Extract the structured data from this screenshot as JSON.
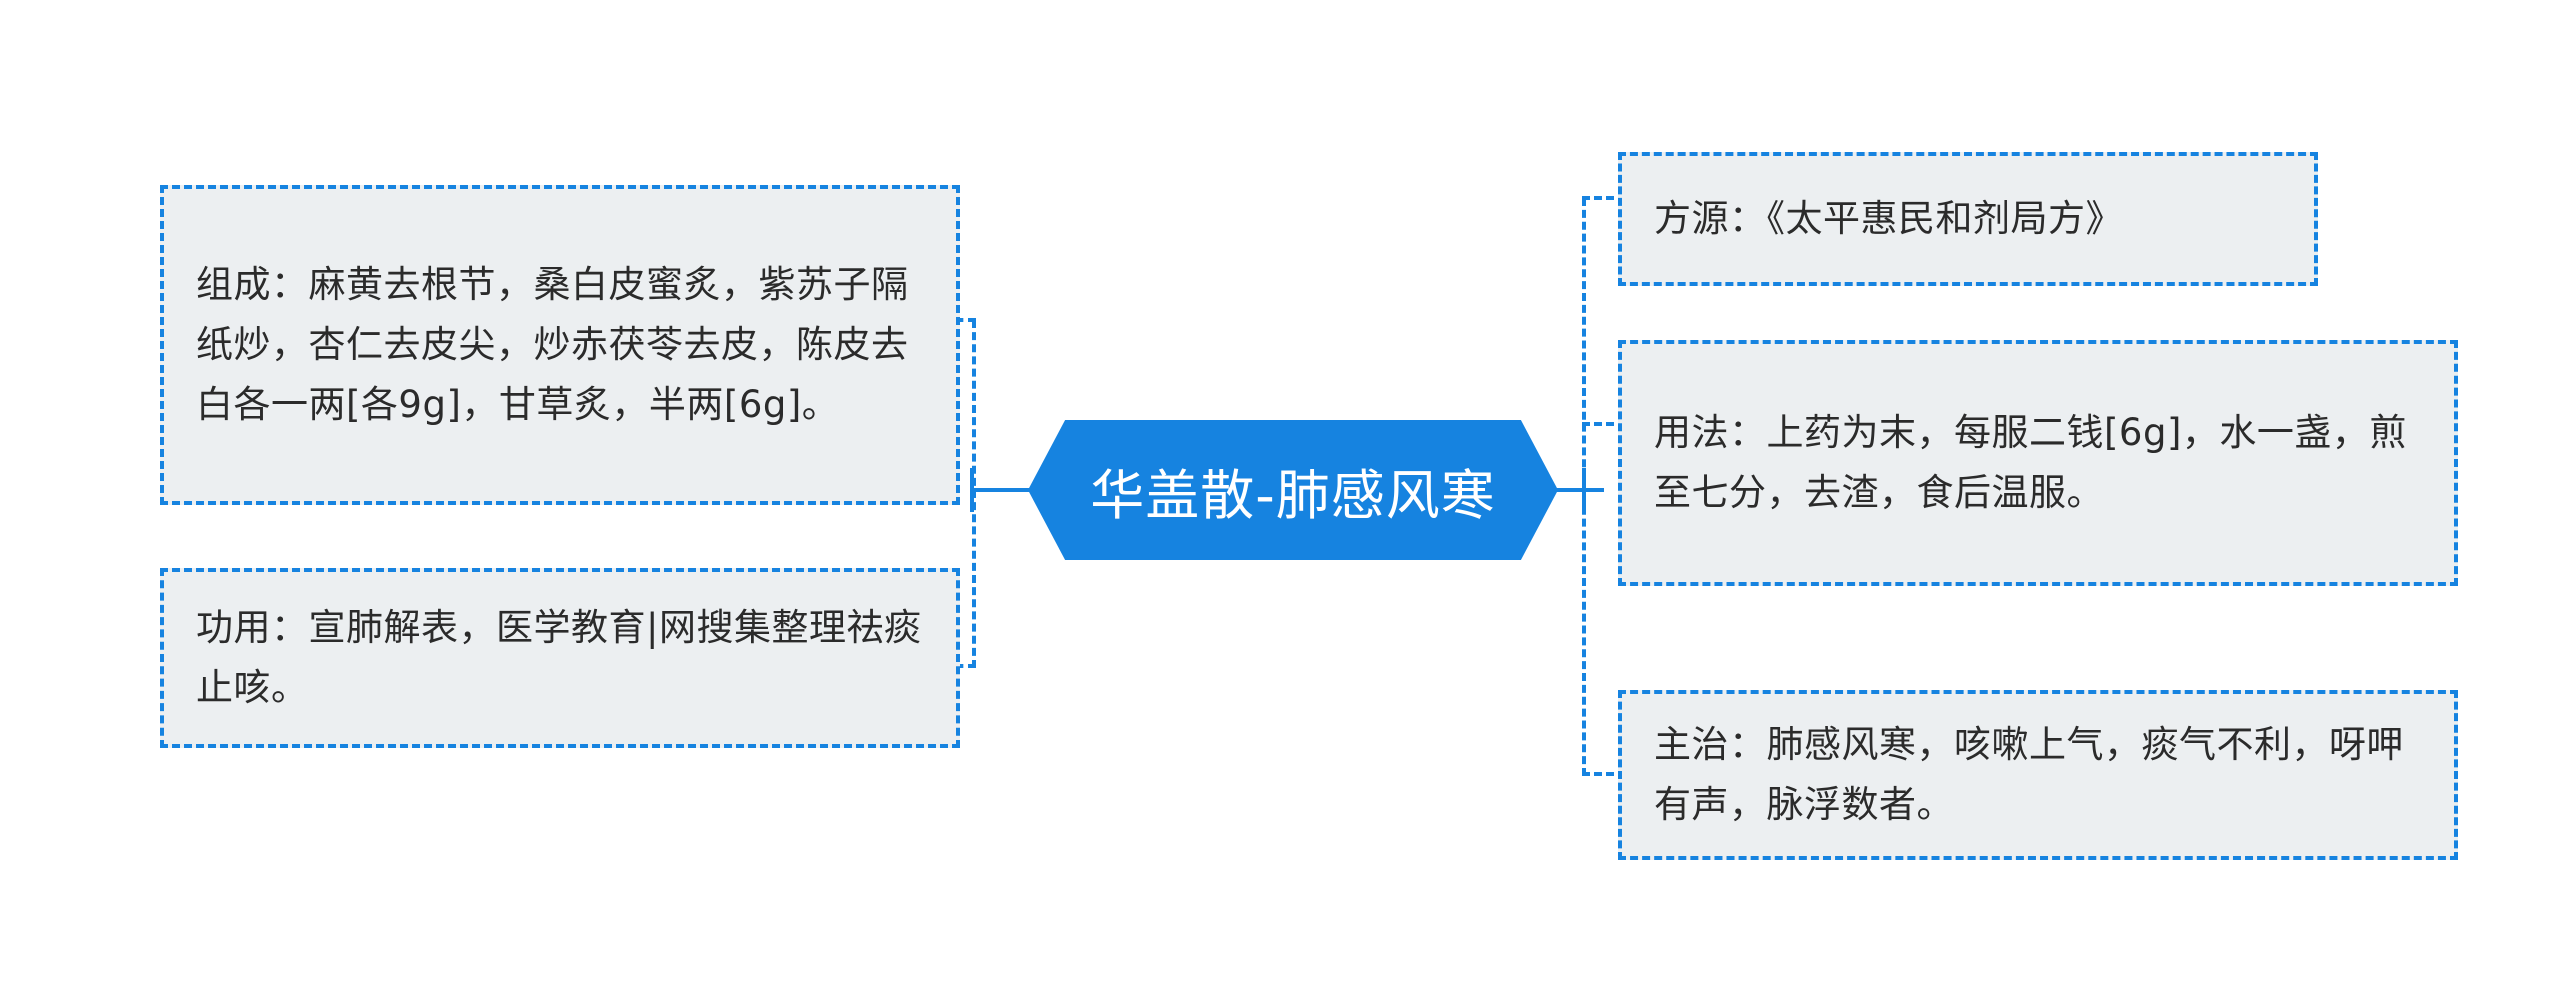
{
  "diagram": {
    "type": "mind-map",
    "orientation": "horizontal-bilateral",
    "center": {
      "label": "华盖散-肺感风寒",
      "shape": "hexagon",
      "fill": "#1683e0",
      "text_color": "#ffffff"
    },
    "style": {
      "branch_color": "#1683e0",
      "box_fill": "#eceff1",
      "box_border_style": "dashed",
      "box_text_color": "#2b2b2b",
      "background": "#ffffff"
    },
    "branches": {
      "left": [
        {
          "id": "composition",
          "label": "组成",
          "text": "组成：麻黄去根节，桑白皮蜜炙，紫苏子隔纸炒，杏仁去皮尖，炒赤茯苓去皮，陈皮去白各一两[各9g]，甘草炙，半两[6g]。"
        },
        {
          "id": "function",
          "label": "功用",
          "text": "功用：宣肺解表，医学教育|网搜集整理祛痰止咳。"
        }
      ],
      "right": [
        {
          "id": "source",
          "label": "方源",
          "text": "方源：《太平惠民和剂局方》"
        },
        {
          "id": "usage",
          "label": "用法",
          "text": "用法：上药为末，每服二钱[6g]，水一盏，煎至七分，去渣，食后温服。"
        },
        {
          "id": "indication",
          "label": "主治",
          "text": "主治：肺感风寒，咳嗽上气，痰气不利，呀呷有声，脉浮数者。"
        }
      ]
    }
  }
}
